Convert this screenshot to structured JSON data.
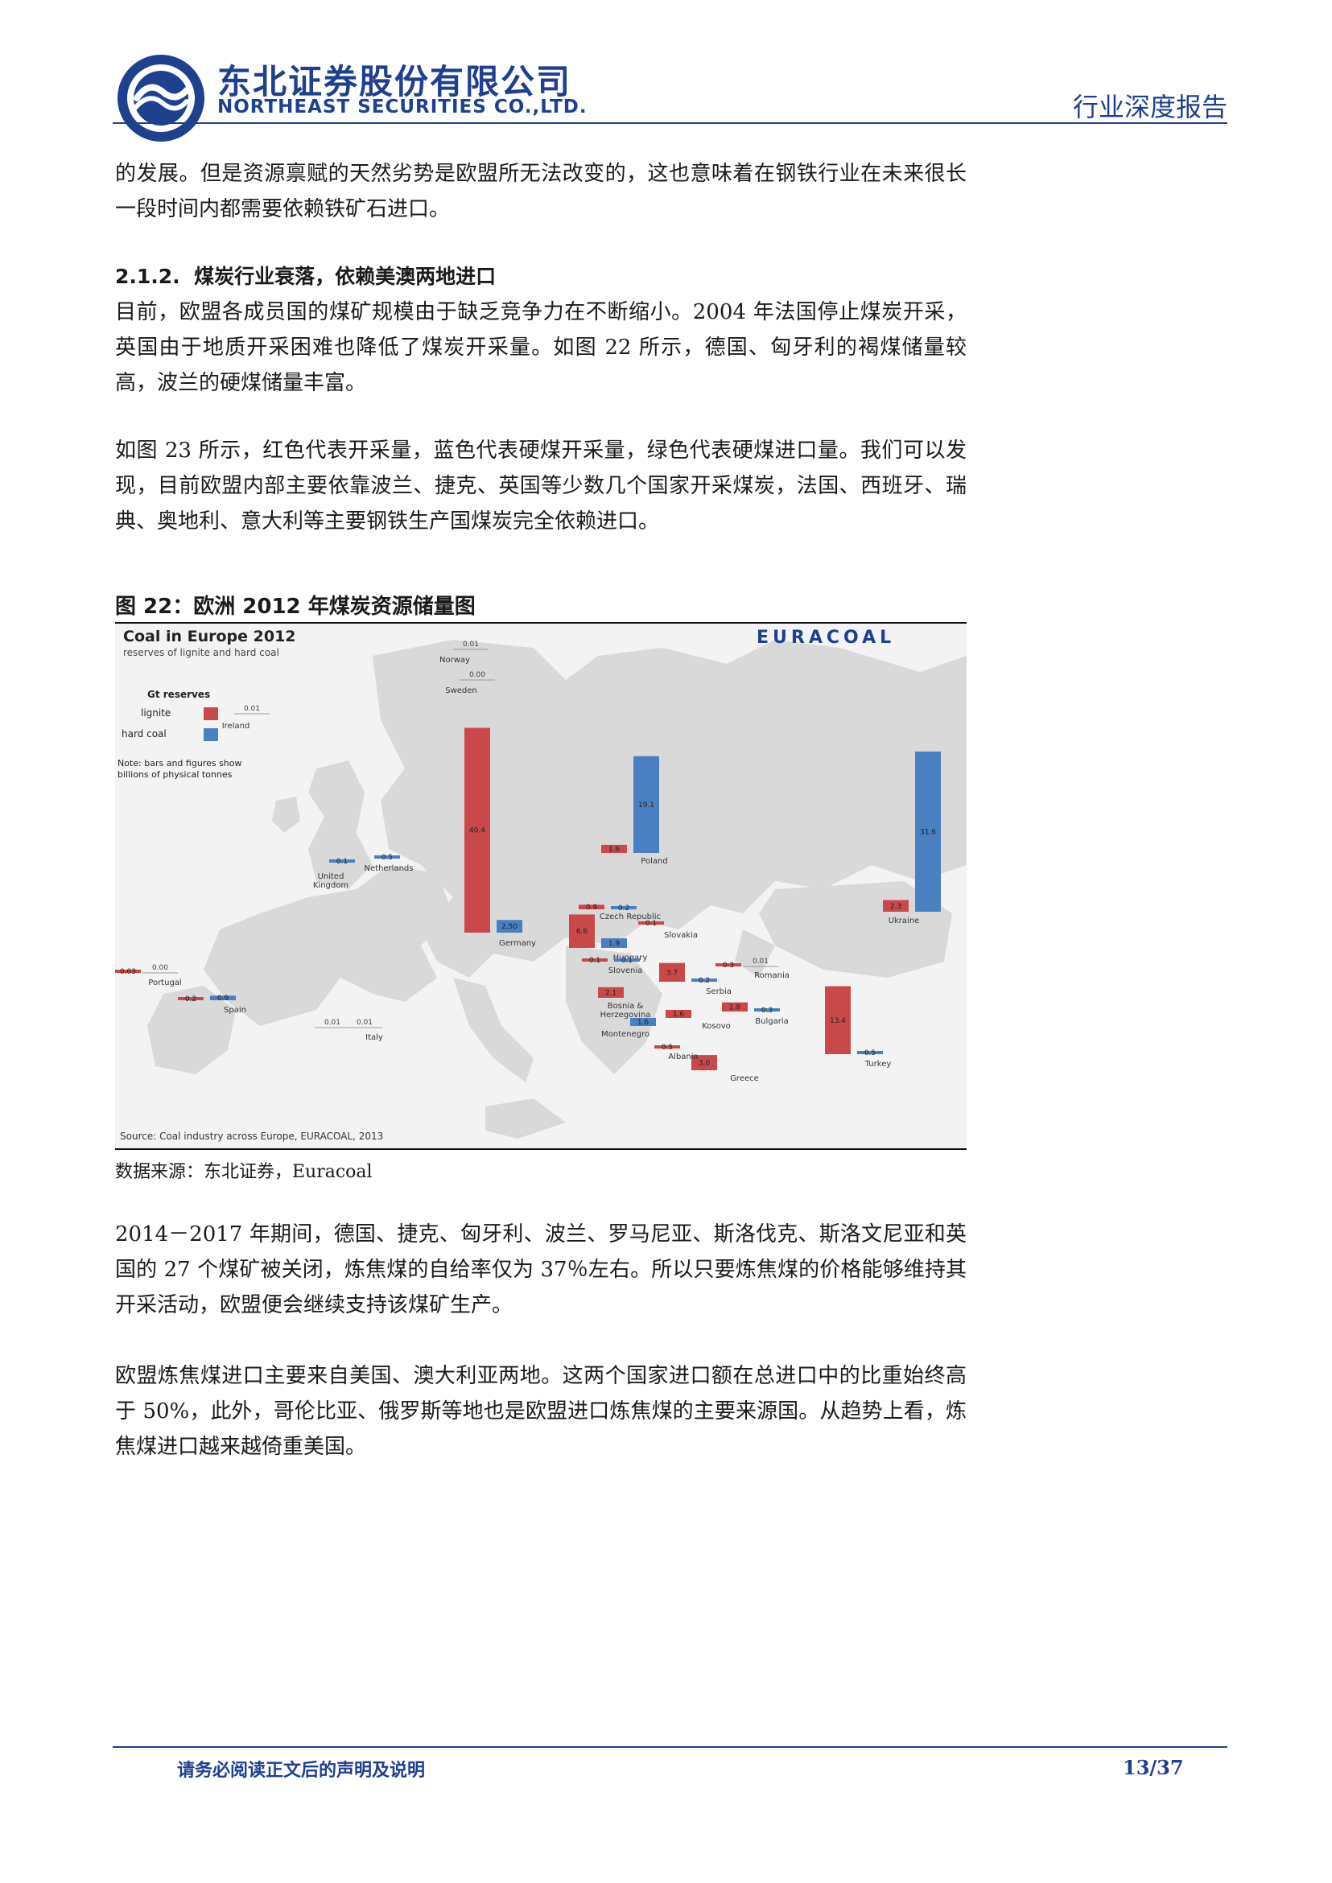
{
  "header": {
    "company_cn": "东北证券股份有限公司",
    "company_en": "NORTHEAST SECURITIES CO.,LTD.",
    "report_type": "行业深度报告"
  },
  "paragraphs": {
    "p1": "的发展。但是资源禀赋的天然劣势是欧盟所无法改变的，这也意味着在钢铁行业在未来很长一段时间内都需要依赖铁矿石进口。",
    "p2": "目前，欧盟各成员国的煤矿规模由于缺乏竞争力在不断缩小。2004 年法国停止煤炭开采，英国由于地质开采困难也降低了煤炭开采量。如图 22 所示，德国、匈牙利的褐煤储量较高，波兰的硬煤储量丰富。",
    "p3": "如图 23 所示，红色代表开采量，蓝色代表硬煤开采量，绿色代表硬煤进口量。我们可以发现，目前欧盟内部主要依靠波兰、捷克、英国等少数几个国家开采煤炭，法国、西班牙、瑞典、奥地利、意大利等主要钢铁生产国煤炭完全依赖进口。",
    "p4": "2014－2017 年期间，德国、捷克、匈牙利、波兰、罗马尼亚、斯洛伐克、斯洛文尼亚和英国的 27 个煤矿被关闭，炼焦煤的自给率仅为 37％左右。所以只要炼焦煤的价格能够维持其开采活动，欧盟便会继续支持该煤矿生产。",
    "p5": "欧盟炼焦煤进口主要来自美国、澳大利亚两地。这两个国家进口额在总进口中的比重始终高于 50%，此外，哥伦比亚、俄罗斯等地也是欧盟进口炼焦煤的主要来源国。从趋势上看，炼焦煤进口越来越倚重美国。"
  },
  "section": {
    "number": "2.1.2.",
    "title": "煤炭行业衰落，依赖美澳两地进口"
  },
  "figure": {
    "caption": "图 22：欧洲 2012 年煤炭资源储量图",
    "source": "数据来源：东北证券，Euracoal"
  },
  "map_text": {
    "title": "Coal in Europe 2012",
    "subtitle": "reserves of lignite and hard coal",
    "brand": "EURACOAL",
    "legend_header": "Gt   reserves",
    "legend_lignite": "lignite",
    "legend_hardcoal": "hard coal",
    "note_line1": "Note: bars and figures show",
    "note_line2": "billions of physical tonnes",
    "source": "Source: Coal industry across Europe, EURACOAL, 2013"
  },
  "colors": {
    "lignite": "#c9484a",
    "hard_coal": "#4a7fc1",
    "brand_blue": "#1f3f8f"
  },
  "chart_data": {
    "type": "bar",
    "title": "Coal in Europe 2012",
    "subtitle": "reserves of lignite and hard coal",
    "unit": "Gt",
    "series_names": [
      "lignite",
      "hard coal"
    ],
    "countries": [
      {
        "name": "Germany",
        "lignite": "40.4",
        "hard_coal": "2.50"
      },
      {
        "name": "Poland",
        "lignite": "1.6",
        "hard_coal": "19.1"
      },
      {
        "name": "Ukraine",
        "lignite": "2.3",
        "hard_coal": "31.6"
      },
      {
        "name": "Turkey",
        "lignite": "13.4",
        "hard_coal": "0.5"
      },
      {
        "name": "Hungary",
        "lignite": "6.6",
        "hard_coal": "1.9"
      },
      {
        "name": "Greece",
        "lignite": "3.0",
        "hard_coal": ""
      },
      {
        "name": "Serbia",
        "lignite": "3.7",
        "hard_coal": "0.2"
      },
      {
        "name": "Bosnia & Herzegovina",
        "lignite": "2.1",
        "hard_coal": ""
      },
      {
        "name": "Kosovo",
        "lignite": "1.6",
        "hard_coal": ""
      },
      {
        "name": "Montenegro",
        "lignite": "",
        "hard_coal": "1.6"
      },
      {
        "name": "Bulgaria",
        "lignite": "1.8",
        "hard_coal": "0.3"
      },
      {
        "name": "Czech Republic",
        "lignite": "0.9",
        "hard_coal": "0.2"
      },
      {
        "name": "Slovakia",
        "lignite": "0.1",
        "hard_coal": ""
      },
      {
        "name": "Slovenia",
        "lignite": "0.1",
        "hard_coal": "0.1"
      },
      {
        "name": "Romania",
        "lignite": "0.3",
        "hard_coal": "0.01"
      },
      {
        "name": "Albania",
        "lignite": "0.5",
        "hard_coal": ""
      },
      {
        "name": "United Kingdom",
        "lignite": "",
        "hard_coal": "0.1"
      },
      {
        "name": "Netherlands",
        "lignite": "",
        "hard_coal": "0.5"
      },
      {
        "name": "Spain",
        "lignite": "0.2",
        "hard_coal": "0.9"
      },
      {
        "name": "Portugal",
        "lignite": "0.03",
        "hard_coal": "0.00"
      },
      {
        "name": "Italy",
        "lignite": "0.01",
        "hard_coal": "0.01"
      },
      {
        "name": "Ireland",
        "lignite": "",
        "hard_coal": "0.01"
      },
      {
        "name": "Norway",
        "lignite": "",
        "hard_coal": "0.01"
      },
      {
        "name": "Sweden",
        "lignite": "",
        "hard_coal": "0.00"
      }
    ]
  },
  "footer": {
    "disclaimer": "请务必阅读正文后的声明及说明",
    "page": "13/37"
  }
}
